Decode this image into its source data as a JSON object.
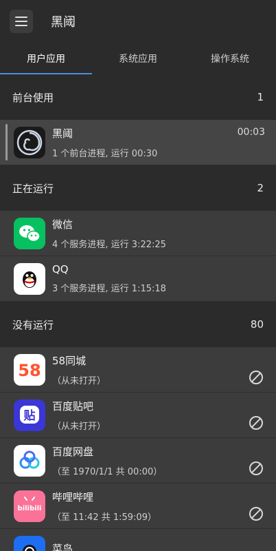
{
  "appbar": {
    "title": "黑阈"
  },
  "tabs": [
    {
      "label": "用户应用",
      "active": true
    },
    {
      "label": "系统应用",
      "active": false
    },
    {
      "label": "操作系统",
      "active": false
    }
  ],
  "sections": {
    "foreground": {
      "title": "前台使用",
      "count": "1"
    },
    "running": {
      "title": "正在运行",
      "count": "2"
    },
    "stopped": {
      "title": "没有运行",
      "count": "80"
    }
  },
  "foreground_apps": [
    {
      "name": "黑阈",
      "sub": "1 个前台进程, 运行 00:30",
      "time": "00:03",
      "icon": "heiyu-icon"
    }
  ],
  "running_apps": [
    {
      "name": "微信",
      "sub": "4 个服务进程, 运行 3:22:25",
      "icon": "wechat-icon"
    },
    {
      "name": "QQ",
      "sub": "3 个服务进程, 运行 1:15:18",
      "icon": "qq-icon"
    }
  ],
  "stopped_apps": [
    {
      "name": "58同城",
      "sub": "（从未打开）",
      "icon": "58-icon",
      "icon_text": "58"
    },
    {
      "name": "百度贴吧",
      "sub": "（从未打开）",
      "icon": "tieba-icon",
      "icon_text": "贴"
    },
    {
      "name": "百度网盘",
      "sub": "（至 1970/1/1 共 00:00）",
      "icon": "baidu-pan-icon"
    },
    {
      "name": "哔哩哔哩",
      "sub": "（至 11:42 共 1:59:09）",
      "icon": "bilibili-icon",
      "icon_text": "bilibili"
    },
    {
      "name": "菜鸟",
      "sub": "",
      "icon": "cainiao-icon"
    }
  ],
  "colors": {
    "accent": "#4a90d9",
    "background": "#2e2e2e",
    "row": "#3c3c3c"
  }
}
